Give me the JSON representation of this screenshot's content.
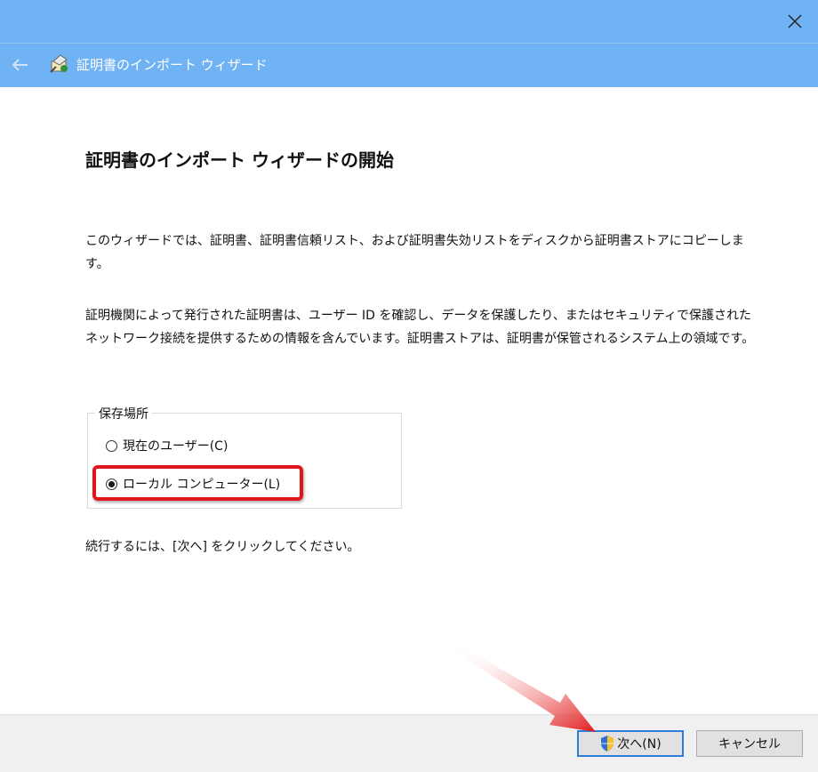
{
  "header": {
    "title": "証明書のインポート ウィザード",
    "back_icon": "back-arrow-icon",
    "wizard_icon": "certificate-wizard-icon"
  },
  "titlebar": {
    "close_icon": "close-icon"
  },
  "main": {
    "heading": "証明書のインポート ウィザードの開始",
    "paragraph1": "このウィザードでは、証明書、証明書信頼リスト、および証明書失効リストをディスクから証明書ストアにコピーします。",
    "paragraph2": "証明機関によって発行された証明書は、ユーザー ID を確認し、データを保護したり、またはセキュリティで保護されたネットワーク接続を提供するための情報を含んでいます。証明書ストアは、証明書が保管されるシステム上の領域です。",
    "store_location": {
      "legend": "保存場所",
      "options": [
        {
          "label": "現在のユーザー(C)",
          "checked": false
        },
        {
          "label": "ローカル コンピューター(L)",
          "checked": true
        }
      ]
    },
    "paragraph3": "続行するには、[次へ] をクリックしてください。"
  },
  "footer": {
    "next_label": "次へ(N)",
    "cancel_label": "キャンセル",
    "shield_icon": "uac-shield-icon"
  },
  "colors": {
    "titlebar": "#6fb3f5",
    "highlight": "#e0161b",
    "button_focus": "#2d7cd8"
  }
}
